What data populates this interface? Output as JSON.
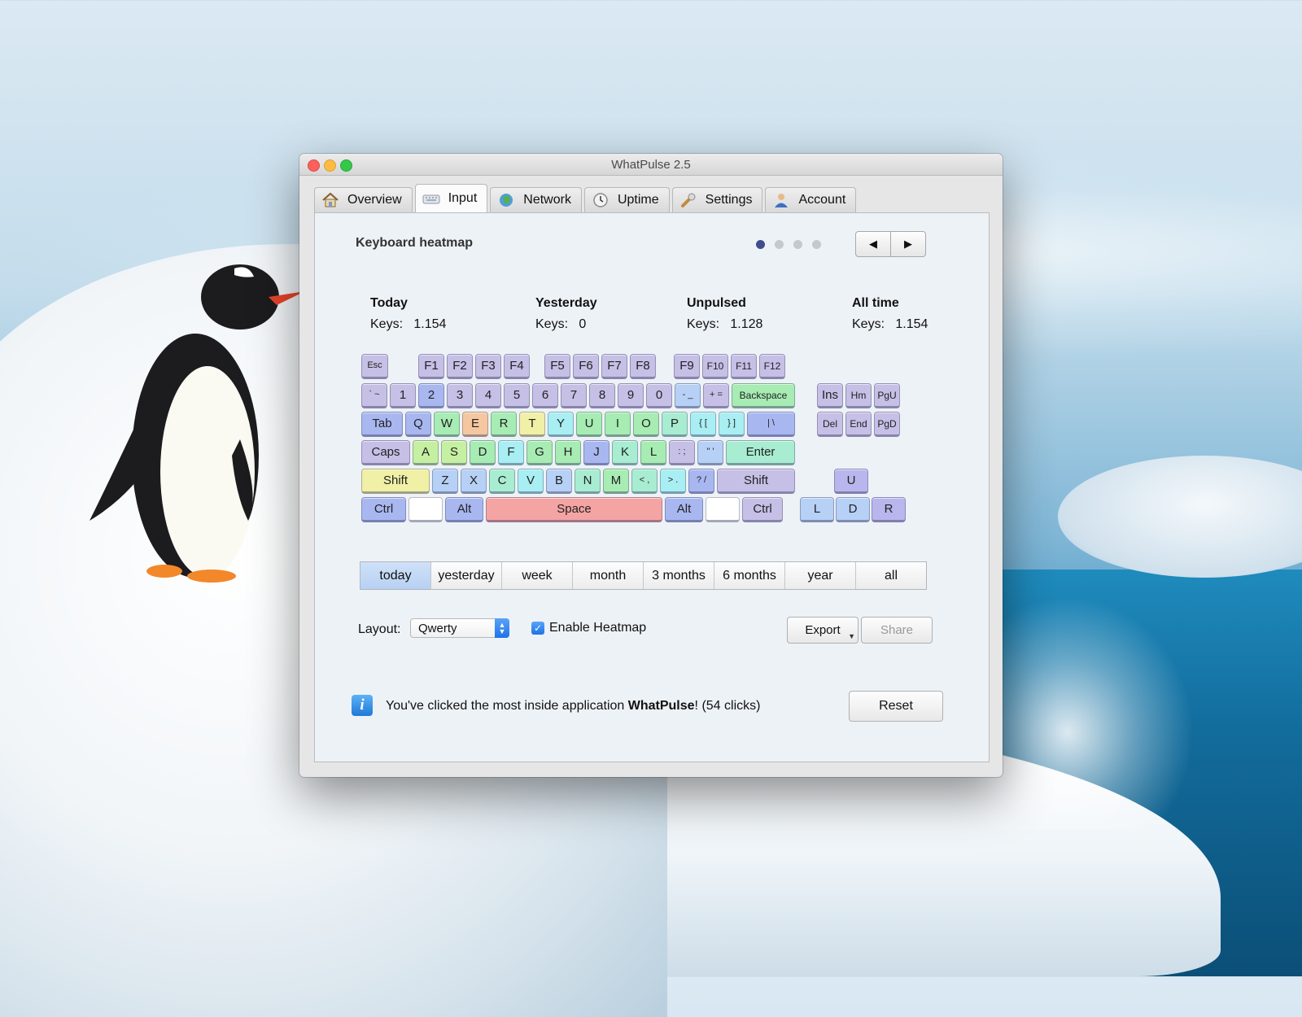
{
  "window": {
    "title": "WhatPulse 2.5"
  },
  "tabs": [
    {
      "label": "Overview",
      "icon": "home-icon"
    },
    {
      "label": "Input",
      "icon": "keyboard-icon",
      "active": true
    },
    {
      "label": "Network",
      "icon": "globe-icon"
    },
    {
      "label": "Uptime",
      "icon": "clock-icon"
    },
    {
      "label": "Settings",
      "icon": "wrench-icon"
    },
    {
      "label": "Account",
      "icon": "user-icon"
    }
  ],
  "panel": {
    "heading": "Keyboard heatmap",
    "pager": {
      "pages": 4,
      "current": 1
    },
    "nav": {
      "prev": "◀",
      "next": "▶"
    }
  },
  "stats": [
    {
      "title": "Today",
      "keys_label": "Keys:",
      "keys_value": "1.154"
    },
    {
      "title": "Yesterday",
      "keys_label": "Keys:",
      "keys_value": "0"
    },
    {
      "title": "Unpulsed",
      "keys_label": "Keys:",
      "keys_value": "1.128"
    },
    {
      "title": "All time",
      "keys_label": "Keys:",
      "keys_value": "1.154"
    }
  ],
  "keyboard": {
    "rows": [
      [
        "Esc",
        "F1",
        "F2",
        "F3",
        "F4",
        "F5",
        "F6",
        "F7",
        "F8",
        "F9",
        "F10",
        "F11",
        "F12"
      ],
      [
        "` ~",
        "1",
        "2",
        "3",
        "4",
        "5",
        "6",
        "7",
        "8",
        "9",
        "0",
        "- _",
        "+ =",
        "Backspace",
        "Ins",
        "Hm",
        "PgU"
      ],
      [
        "Tab",
        "Q",
        "W",
        "E",
        "R",
        "T",
        "Y",
        "U",
        "I",
        "O",
        "P",
        "{ [",
        "} ]",
        "| \\",
        "Del",
        "End",
        "PgD"
      ],
      [
        "Caps",
        "A",
        "S",
        "D",
        "F",
        "G",
        "H",
        "J",
        "K",
        "L",
        ": ;",
        "\" '",
        "Enter"
      ],
      [
        "Shift",
        "Z",
        "X",
        "C",
        "V",
        "B",
        "N",
        "M",
        "< ,",
        "> .",
        "? /",
        "Shift",
        "U"
      ],
      [
        "Ctrl",
        "",
        "Alt",
        "Space",
        "Alt",
        "",
        "Ctrl",
        "L",
        "D",
        "R"
      ]
    ],
    "heat_colors": {
      "low": "#c6bfe6",
      "medium_low": "#a9b7f0",
      "medium": "#a8eef2",
      "medium_high": "#a7ecb3",
      "high": "#f0f0a6",
      "higher": "#f5c7a0",
      "highest": "#f5a4a4"
    }
  },
  "time_ranges": [
    {
      "label": "today",
      "selected": true
    },
    {
      "label": "yesterday"
    },
    {
      "label": "week"
    },
    {
      "label": "month"
    },
    {
      "label": "3 months"
    },
    {
      "label": "6 months"
    },
    {
      "label": "year"
    },
    {
      "label": "all"
    }
  ],
  "options": {
    "layout_label": "Layout:",
    "layout_value": "Qwerty",
    "heatmap_label": "Enable Heatmap",
    "heatmap_checked": true,
    "export_label": "Export",
    "share_label": "Share"
  },
  "info": {
    "text_before": "You've clicked the most inside application ",
    "app_name": "WhatPulse",
    "text_after": "! (54 clicks)",
    "reset_label": "Reset"
  }
}
